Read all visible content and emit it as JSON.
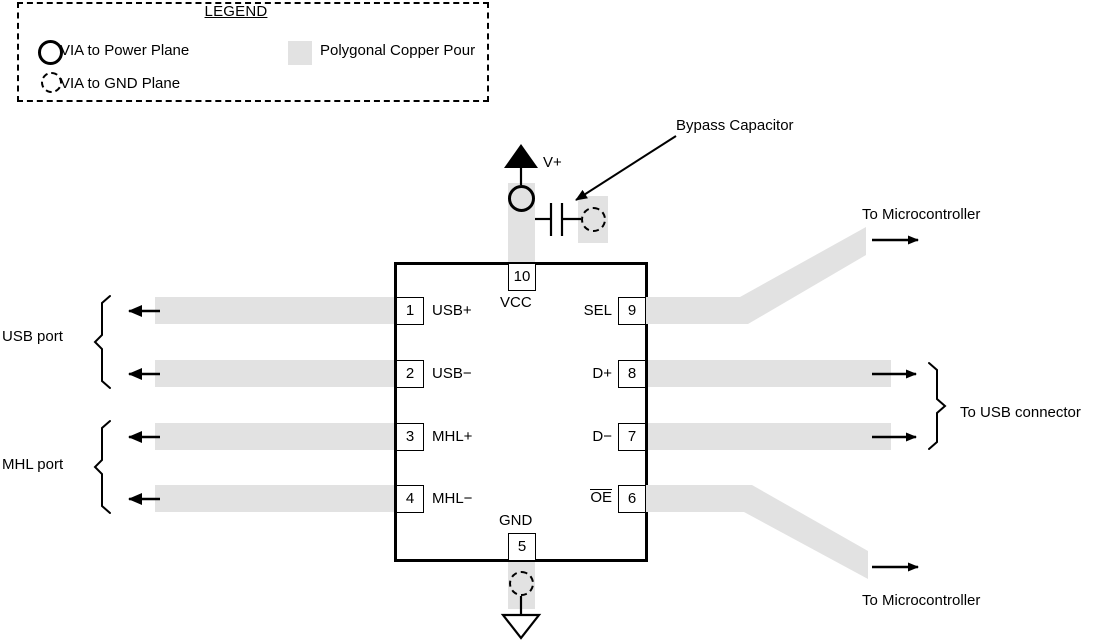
{
  "legend": {
    "title": "LEGEND",
    "items": [
      {
        "icon": "via-power-circle-icon",
        "label": "VIA to Power Plane"
      },
      {
        "icon": "via-gnd-dashed-circle-icon",
        "label": "VIA to GND Plane"
      },
      {
        "icon": "copper-pour-swatch-icon",
        "label": "Polygonal Copper Pour"
      }
    ]
  },
  "ic": {
    "pins_left": [
      {
        "number": "1",
        "name": "USB+"
      },
      {
        "number": "2",
        "name": "USB−"
      },
      {
        "number": "3",
        "name": "MHL+"
      },
      {
        "number": "4",
        "name": "MHL−"
      }
    ],
    "pins_right": [
      {
        "number": "9",
        "name": "SEL",
        "overline": false
      },
      {
        "number": "8",
        "name": "D+",
        "overline": false
      },
      {
        "number": "7",
        "name": "D−",
        "overline": false
      },
      {
        "number": "6",
        "name": "OE",
        "overline": true
      }
    ],
    "pin_top": {
      "number": "10",
      "name": "VCC"
    },
    "pin_bottom": {
      "number": "5",
      "name": "GND"
    }
  },
  "annotations": {
    "power_rail": "V+",
    "bypass_capacitor": "Bypass Capacitor",
    "usb_port": "USB port",
    "mhl_port": "MHL port",
    "usb_connector": "To USB connector",
    "microcontroller_top": "To Microcontroller",
    "microcontroller_bottom": "To Microcontroller"
  },
  "colors": {
    "copper_pour": "#e2e2e2",
    "outline": "#000000",
    "background": "#ffffff"
  }
}
